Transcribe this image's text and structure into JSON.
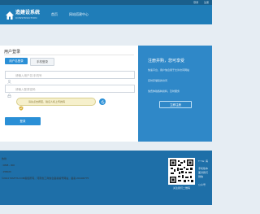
{
  "topbar": {
    "links": [
      "登录",
      "注册"
    ]
  },
  "header": {
    "logo_text": "造建设系统",
    "logo_sub": "CONSTRUCTION",
    "nav": [
      {
        "label": "首页"
      },
      {
        "label": "网站搭建中心"
      }
    ]
  },
  "login": {
    "title": "用户登录",
    "tabs": [
      {
        "label": "用户名登录",
        "active": true
      },
      {
        "label": "手机登录",
        "active": false
      }
    ],
    "username_placeholder": "请输入用户名/手机号",
    "password_placeholder": "请输入登录密码",
    "captcha_text": "请先点击按钮，验证人机上传的码",
    "submit_label": "登录"
  },
  "promo": {
    "title": "注册并购，您可享受",
    "lines": [
      "快速平台，用户信息用于允许访问网站",
      "实时存储您的访问",
      "免费体验各种资料，及时服务"
    ],
    "register_label": "立即注册"
  },
  "footer": {
    "hotline_label": "热线",
    "phone": ": 0898 - 000",
    "qq": ": 258029",
    "copyright": "©2014 TAMTIS.COM版权所有，河南省工商信息备案编号网站，备案 201400775",
    "qr_caption": "关注我们二维码",
    "side": [
      "T T E: 海",
      "手机版本",
      "面对我们",
      "微信",
      "公众号"
    ]
  },
  "colors": {
    "topbar": "#1a5f8c",
    "header": "#1f7db8",
    "accent": "#2a8fd6",
    "promo_panel": "#2f88c8",
    "footer": "#1e6fa8",
    "page_bg": "#e6edf3"
  },
  "icons": {
    "logo": "house-logo-icon",
    "username": "user-icon",
    "password": "lock-icon",
    "captcha": "shield-check-icon",
    "refresh": "refresh-icon",
    "qr": "qr-code-icon"
  }
}
